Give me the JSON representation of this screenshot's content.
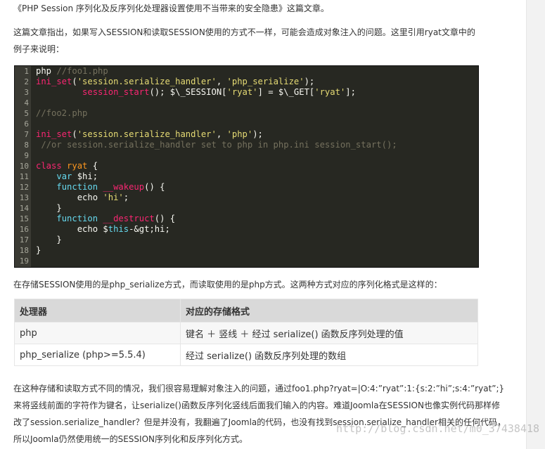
{
  "article": {
    "top_line": "《PHP Session 序列化及反序列化处理器设置使用不当带来的安全隐患》这篇文章。",
    "intro": "这篇文章指出，如果写入SESSION和读取SESSION使用的方式不一样，可能会造成对象注入的问题。这里引用ryat文章中的例子来说明：",
    "mid": "在存储SESSION使用的是php_serialize方式，而读取使用的是php方式。这两种方式对应的序列化格式是这样的：",
    "bottom": "在这种存储和读取方式不同的情况，我们很容易理解对象注入的问题，通过foo1.php?ryat=|O:4:”ryat”:1:{s:2:”hi”;s:4:”ryat”;}来将竖线前面的字符作为键名，让serialize()函数反序列化竖线后面我们输入的内容。难道Joomla在SESSION也像实例代码那样修改了session.serialize_handler？但是并没有，我翻遍了Joomla的代码，也没有找到session.serialize_handler相关的任何代码，所以Joomla仍然使用统一的SESSION序列化和反序列化方式。"
  },
  "code": {
    "line_numbers": [
      "1",
      "2",
      "3",
      "4",
      "5",
      "6",
      "7",
      "8",
      "9",
      "10",
      "11",
      "12",
      "13",
      "14",
      "15",
      "16",
      "17",
      "18",
      "19"
    ],
    "l1_kw": "php",
    "l1_c": " //foo1.php",
    "l2_fn": "ini_set",
    "l2_a": "(",
    "l2_s1": "'session.serialize_handler'",
    "l2_b": ", ",
    "l2_s2": "'php_serialize'",
    "l2_c": ");",
    "l3_fn": "session_start",
    "l3_a": "(); $\\_SESSION[",
    "l3_s": "'ryat'",
    "l3_b": "] = $\\_GET[",
    "l3_s2": "'ryat'",
    "l3_c": "];",
    "l5_c": "//foo2.php",
    "l7_fn": "ini_set",
    "l7_a": "(",
    "l7_s1": "'session.serialize_handler'",
    "l7_b": ", ",
    "l7_s2": "'php'",
    "l7_c": ");",
    "l8_c": "//or session.serialize_handler set to php in php.ini session_start();",
    "l10_kw": "class",
    "l10_n": " ryat",
    "l10_p": " {",
    "l11_kw": "var",
    "l11_p": " $hi;",
    "l12_kw": "function",
    "l12_fn": " __wakeup",
    "l12_p": "() {",
    "l13_p": "echo ",
    "l13_s": "'hi'",
    "l13_e": ";",
    "l14_p": "}",
    "l15_kw": "function",
    "l15_fn": " __destruct",
    "l15_p": "() {",
    "l16_p": "echo $",
    "l16_kw": "this",
    "l16_e": "-&gt;hi;",
    "l17_p": "}",
    "l18_p": "}"
  },
  "table": {
    "headers": [
      "处理器",
      "对应的存储格式"
    ],
    "rows": [
      [
        "php",
        "键名 ＋ 竖线 ＋ 经过 serialize() 函数反序列处理的值"
      ],
      [
        "php_serialize (php>=5.5.4)",
        "经过 serialize() 函数反序列处理的数组"
      ]
    ]
  },
  "watermark": "http://blog.csdn.net/m0_37438418"
}
